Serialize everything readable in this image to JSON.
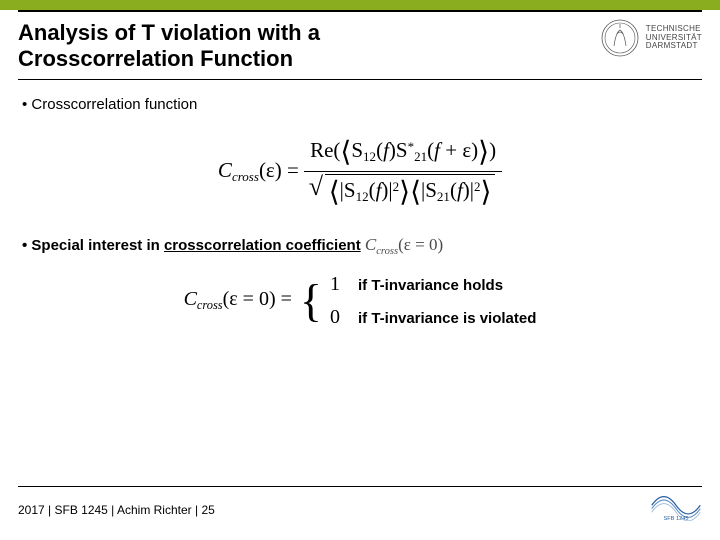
{
  "header": {
    "title_line1": "Analysis of T violation with a",
    "title_line2": "Crosscorrelation Function",
    "uni_line1": "TECHNISCHE",
    "uni_line2": "UNIVERSITÄT",
    "uni_line3": "DARMSTADT"
  },
  "body": {
    "bullet1": "Crosscorrelation function",
    "formula": {
      "lhs_base": "C",
      "lhs_sub": "cross",
      "lhs_arg": "(ε) =",
      "re": "Re",
      "s12": "S",
      "s12_sub": "12",
      "s21": "S",
      "s21_sub": "21",
      "f": "f",
      "eps": "ε",
      "star": "*",
      "abs2": "2"
    },
    "bullet2_a": "Special interest in ",
    "bullet2_b": "crosscorrelation coefficient",
    "coeff_base": "C",
    "coeff_sub": "cross",
    "coeff_arg": "(ε = 0)",
    "piecewise": {
      "lhs_base": "C",
      "lhs_sub": "cross",
      "lhs_arg": "(ε = 0) =",
      "case1_val": "1",
      "case1_txt": "if T-invariance holds",
      "case2_val": "0",
      "case2_txt": "if T-invariance is violated"
    }
  },
  "footer": {
    "text": "2017 | SFB 1245 | Achim Richter | 25",
    "sfb": "SFB 1245"
  }
}
